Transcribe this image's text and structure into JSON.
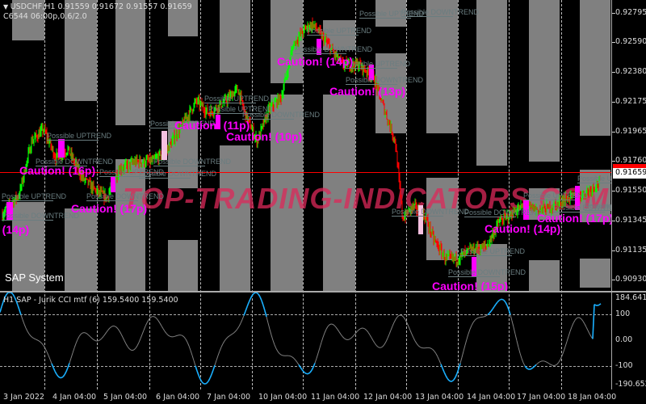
{
  "header": {
    "symbol_line": "USDCHF,H1  0.91559 0.91672 0.91557 0.91659",
    "sub_line": "C6544 06:00p,0.6/2.0"
  },
  "indicator": {
    "label": "H1 SAP - Jurik CCI mtf (6) 159.5400 159.5400",
    "system_label": "SAP System",
    "axis": [
      "184.6413",
      "100",
      "0.00",
      "-100",
      "-190.6523"
    ],
    "levels": [
      100,
      0,
      -100
    ],
    "range": [
      -190.6523,
      184.6413
    ]
  },
  "watermark": "TOP-TRADING-INDICATORS.COM",
  "trend_labels": {
    "up": "Possible UPTREND",
    "down": "Possible DOWNTREND"
  },
  "cautions": [
    "Caution! (16p)",
    "Caution! (17p)",
    "Caution! (14p)",
    "Caution! (11p)",
    "Caution! (10p)",
    "Caution! (14p)",
    "Caution! (13p)",
    "Caution! (14p)",
    "Caution! (17p)",
    "Caution! (15p)"
  ],
  "colors": {
    "bull": "#00ff00",
    "bear": "#ff0000",
    "caution": "#ff00ff",
    "cci_extreme": "#1ab0ff",
    "cci_normal": "#808080",
    "zone": "#808080",
    "price_line": "#ff0000"
  },
  "chart_data": {
    "type": "candlestick",
    "symbol": "USDCHF",
    "timeframe": "H1",
    "ylim": [
      0.9083,
      0.92895
    ],
    "y_ticks": [
      "0.92795",
      "0.92590",
      "0.92380",
      "0.92175",
      "0.91965",
      "0.91760",
      "0.91550",
      "0.91345",
      "0.91135",
      "0.90930"
    ],
    "current_price": "0.91659",
    "x_ticks": [
      "3 Jan 2022",
      "4 Jan 04:00",
      "5 Jan 04:00",
      "6 Jan 04:00",
      "7 Jan 04:00",
      "10 Jan 04:00",
      "11 Jan 04:00",
      "12 Jan 04:00",
      "13 Jan 04:00",
      "14 Jan 04:00",
      "17 Jan 04:00",
      "18 Jan 04:00"
    ],
    "price_path": [
      [
        0,
        0.91388
      ],
      [
        7,
        0.91529
      ],
      [
        12,
        0.91896
      ],
      [
        17,
        0.91981
      ],
      [
        22,
        0.91783
      ],
      [
        27,
        0.9184
      ],
      [
        33,
        0.91642
      ],
      [
        38,
        0.91557
      ],
      [
        43,
        0.91501
      ],
      [
        48,
        0.91699
      ],
      [
        55,
        0.91755
      ],
      [
        62,
        0.91755
      ],
      [
        68,
        0.9184
      ],
      [
        75,
        0.92038
      ],
      [
        80,
        0.92179
      ],
      [
        85,
        0.92094
      ],
      [
        92,
        0.92179
      ],
      [
        97,
        0.92264
      ],
      [
        100,
        0.92094
      ],
      [
        105,
        0.91896
      ],
      [
        110,
        0.92122
      ],
      [
        115,
        0.92207
      ],
      [
        120,
        0.92575
      ],
      [
        125,
        0.92688
      ],
      [
        128,
        0.92716
      ],
      [
        133,
        0.92603
      ],
      [
        140,
        0.92433
      ],
      [
        147,
        0.92433
      ],
      [
        153,
        0.92349
      ],
      [
        158,
        0.92094
      ],
      [
        162,
        0.91896
      ],
      [
        165,
        0.91359
      ],
      [
        170,
        0.91444
      ],
      [
        175,
        0.91359
      ],
      [
        178,
        0.91218
      ],
      [
        183,
        0.91077
      ],
      [
        188,
        0.91077
      ],
      [
        193,
        0.91133
      ],
      [
        200,
        0.91162
      ],
      [
        205,
        0.91331
      ],
      [
        210,
        0.91388
      ],
      [
        215,
        0.91444
      ],
      [
        222,
        0.91416
      ],
      [
        228,
        0.91444
      ],
      [
        233,
        0.91501
      ],
      [
        240,
        0.91529
      ],
      [
        247,
        0.91614
      ]
    ]
  }
}
